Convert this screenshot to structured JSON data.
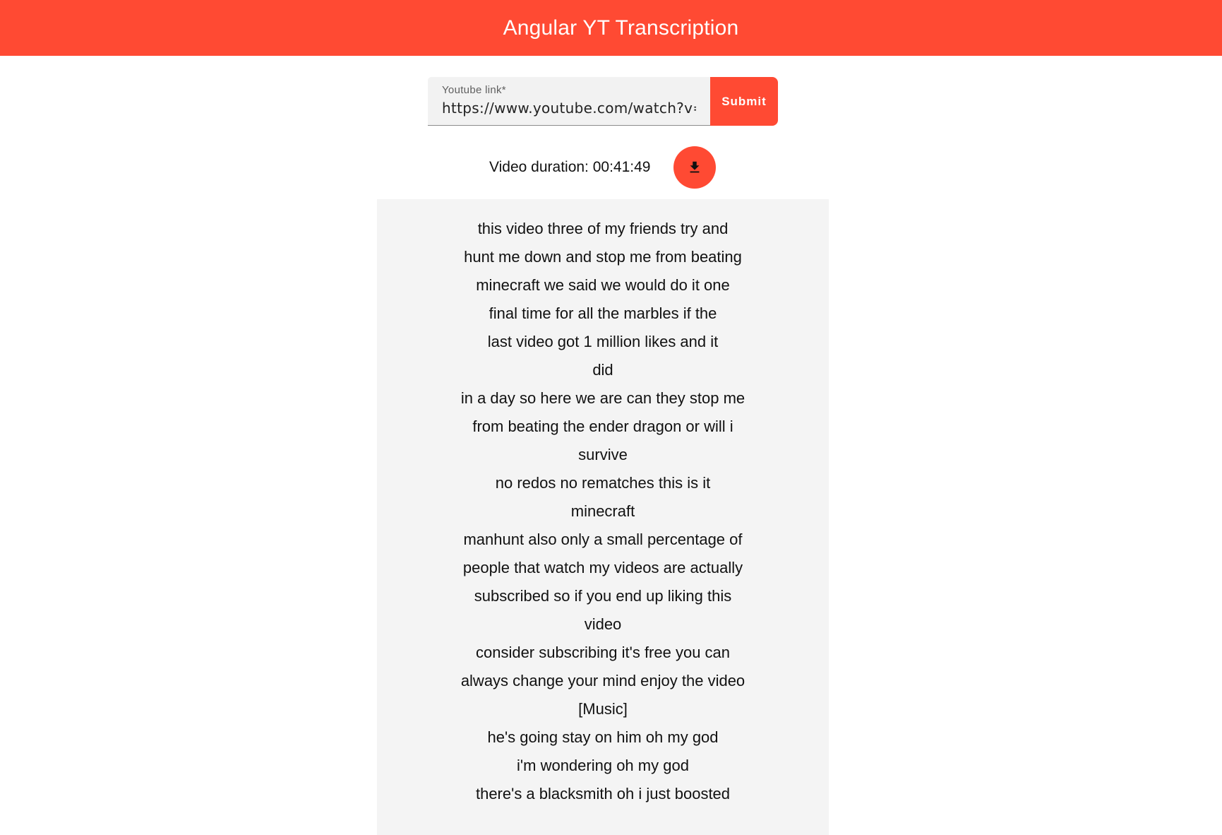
{
  "header": {
    "title": "Angular YT Transcription",
    "color": "#ff4a33"
  },
  "form": {
    "label": "Youtube link*",
    "value": "https://www.youtube.com/watch?v=ty",
    "submit_label": "Submit"
  },
  "info": {
    "duration_text": "Video duration: 00:41:49",
    "download_icon": "download-icon"
  },
  "transcript": {
    "lines": [
      "this video three of my friends try and",
      "hunt me down and stop me from beating",
      "minecraft we said we would do it one",
      "final time for all the marbles if the",
      "last video got 1 million likes and it",
      "did",
      "in a day so here we are can they stop me",
      "from beating the ender dragon or will i",
      "survive",
      "no redos no rematches this is it",
      "minecraft",
      "manhunt also only a small percentage of",
      "people that watch my videos are actually",
      "subscribed so if you end up liking this",
      "video",
      "consider subscribing it's free you can",
      "always change your mind enjoy the video",
      "[Music]",
      "he's going stay on him oh my god",
      "i'm wondering oh my god",
      "there's a blacksmith oh i just boosted"
    ]
  }
}
